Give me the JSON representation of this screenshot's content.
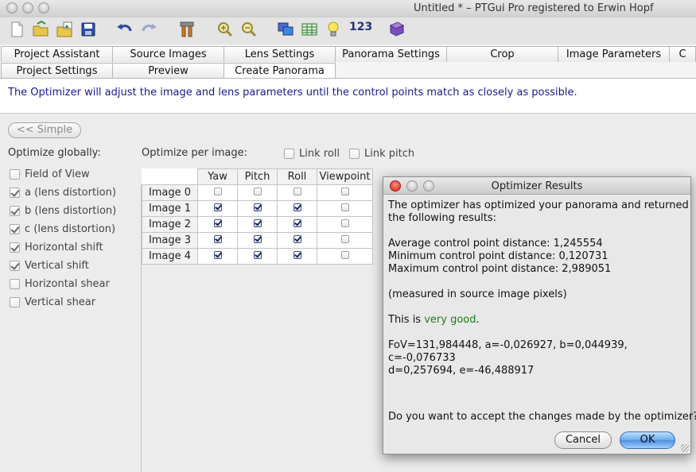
{
  "window": {
    "title": "Untitled * – PTGui Pro registered to Erwin Hopf"
  },
  "toolbar": {
    "icons": [
      "new-document-icon",
      "open-folder-icon",
      "open-images-icon",
      "save-icon",
      "undo-icon",
      "redo-icon",
      "tools-icon",
      "zoom-in-icon",
      "zoom-out-icon",
      "panorama-editor-icon",
      "table-icon",
      "lightbulb-icon",
      "numbers-icon",
      "book-icon"
    ],
    "numbers_label": "123"
  },
  "tabs": {
    "row1": [
      "Project Assistant",
      "Source Images",
      "Lens Settings",
      "Panorama Settings",
      "Crop",
      "Image Parameters",
      "C"
    ],
    "row2": [
      "Project Settings",
      "Preview",
      "Create Panorama"
    ]
  },
  "info_text": "The Optimizer will adjust the image and lens parameters until the control points match as closely as possible.",
  "simple_button": "<< Simple",
  "optimize_globally": {
    "label": "Optimize globally:",
    "items": [
      {
        "label": "Field of View",
        "checked": false
      },
      {
        "label": "a (lens distortion)",
        "checked": true
      },
      {
        "label": "b (lens distortion)",
        "checked": true
      },
      {
        "label": "c (lens distortion)",
        "checked": true
      },
      {
        "label": "Horizontal shift",
        "checked": true
      },
      {
        "label": "Vertical shift",
        "checked": true
      },
      {
        "label": "Horizontal shear",
        "checked": false
      },
      {
        "label": "Vertical shear",
        "checked": false
      }
    ]
  },
  "per_image": {
    "label": "Optimize per image:",
    "link_roll": "Link roll",
    "link_pitch": "Link pitch",
    "columns": [
      "Yaw",
      "Pitch",
      "Roll",
      "Viewpoint"
    ],
    "rows": [
      {
        "name": "Image 0",
        "values": [
          false,
          false,
          false,
          false
        ]
      },
      {
        "name": "Image 1",
        "values": [
          true,
          true,
          true,
          false
        ]
      },
      {
        "name": "Image 2",
        "values": [
          true,
          true,
          true,
          false
        ]
      },
      {
        "name": "Image 3",
        "values": [
          true,
          true,
          true,
          false
        ]
      },
      {
        "name": "Image 4",
        "values": [
          true,
          true,
          true,
          false
        ]
      }
    ]
  },
  "dialog": {
    "title": "Optimizer Results",
    "intro1": "The optimizer has optimized your panorama and returned",
    "intro2": "the following results:",
    "avg": "Average control point distance: 1,245554",
    "min": "Minimum control point distance: 0,120731",
    "max": "Maximum control point distance: 2,989051",
    "measured": "(measured in source image pixels)",
    "quality_prefix": "This is ",
    "quality": "very good",
    "quality_suffix": ".",
    "params1": "FoV=131,984448, a=-0,026927, b=0,044939,",
    "params2": "c=-0,076733",
    "params3": "d=0,257694, e=-46,488917",
    "question": "Do you want to accept the changes made by the optimizer?",
    "cancel": "Cancel",
    "ok": "OK"
  }
}
